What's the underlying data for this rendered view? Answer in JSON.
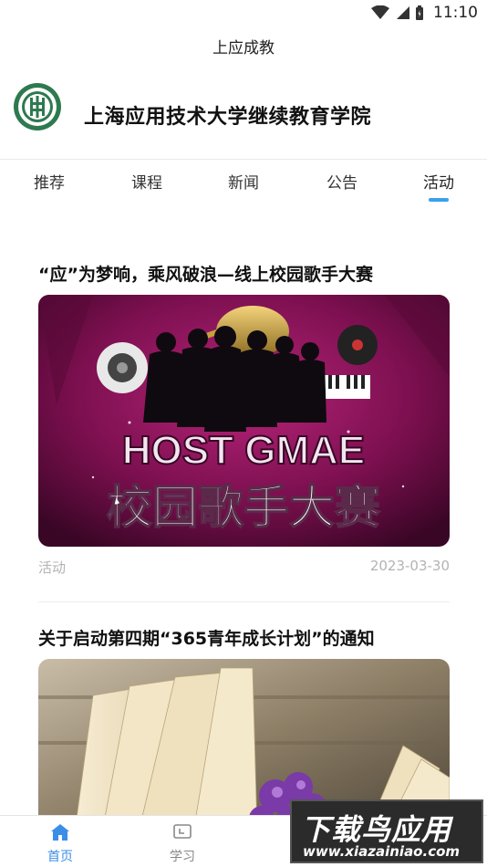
{
  "status_bar": {
    "time": "11:10"
  },
  "app": {
    "title": "上应成教"
  },
  "school": {
    "name": "上海应用技术大学继续教育学院"
  },
  "tabs": [
    {
      "label": "推荐"
    },
    {
      "label": "课程"
    },
    {
      "label": "新闻"
    },
    {
      "label": "公告"
    },
    {
      "label": "活动",
      "active": true
    }
  ],
  "articles": [
    {
      "title": "“应”为梦响，乘风破浪—线上校园歌手大赛",
      "image_text": {
        "banner": "HOST GMAE",
        "caption": "校园歌手大赛"
      },
      "category": "活动",
      "date": "2023-03-30"
    },
    {
      "title": "关于启动第四期“365青年成长计划”的通知"
    }
  ],
  "bottom_nav": {
    "home": "首页",
    "study": "学习"
  },
  "watermark": {
    "main": "下载鸟应用",
    "url": "www.xiazainiao.com"
  },
  "colors": {
    "accent": "#3a8ee8",
    "indicator": "#3aa0ea",
    "meta_text": "#b3b3b3"
  }
}
